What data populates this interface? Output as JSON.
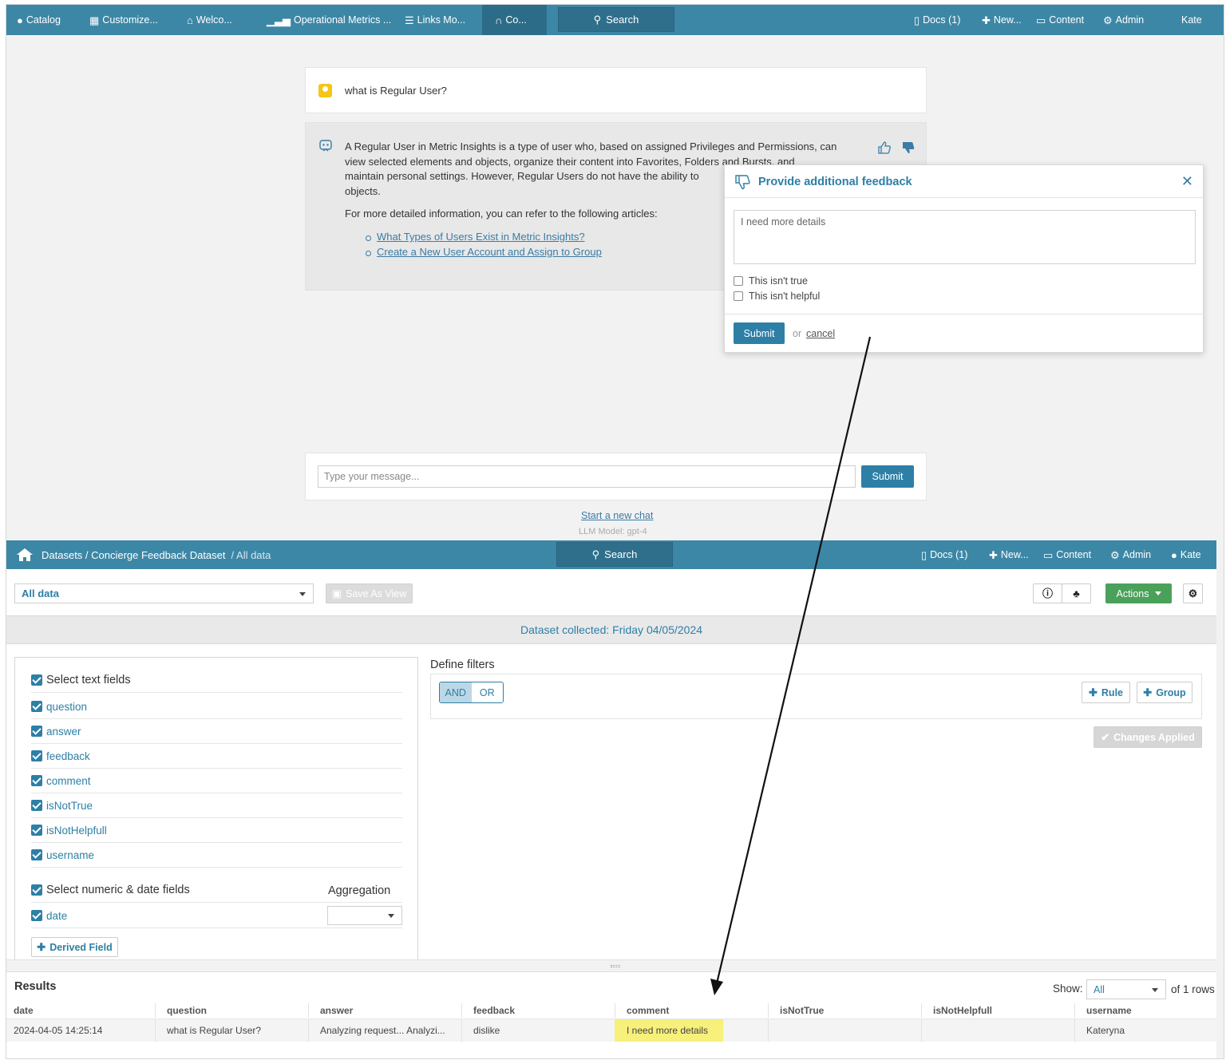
{
  "top_nav": {
    "items": [
      {
        "label": "Catalog",
        "icon": "circle-icon"
      },
      {
        "label": "Customize...",
        "icon": "grid-icon"
      },
      {
        "label": "Welco...",
        "icon": "home-icon"
      },
      {
        "label": "Operational Metrics ...",
        "icon": "bar-chart-icon"
      },
      {
        "label": "Links Mo...",
        "icon": "list-icon"
      },
      {
        "label": "Co...",
        "icon": "headset-icon"
      }
    ],
    "search_label": "Search",
    "docs_label": "Docs (1)",
    "new_label": "New...",
    "content_label": "Content",
    "admin_label": "Admin",
    "user_label": "Kate"
  },
  "chat": {
    "question": "what is Regular User?",
    "answer_lines": [
      "A Regular User in Metric Insights is a type of user who, based on assigned Privileges and Permissions, can",
      "view selected elements and objects, organize their content into Favorites, Folders and Bursts, and",
      "maintain personal settings. However, Regular Users do not have the ability to",
      "objects."
    ],
    "more_info": "For more detailed information, you can refer to the following articles:",
    "links": [
      "What Types of Users Exist in Metric Insights?",
      "Create a New User Account and Assign to Group"
    ],
    "message_placeholder": "Type your message...",
    "submit_label": "Submit",
    "new_chat_label": "Start a new chat",
    "model_label": "LLM Model: gpt-4"
  },
  "feedback_popup": {
    "title": "Provide additional feedback",
    "textarea_value": "I need more details",
    "options": [
      "This isn't true",
      "This isn't helpful"
    ],
    "submit_label": "Submit",
    "or_label": "or",
    "cancel_label": "cancel"
  },
  "dataset_bar": {
    "breadcrumb_main": "Datasets / Concierge Feedback Dataset",
    "breadcrumb_sub": "/ All data",
    "search_label": "Search",
    "docs_label": "Docs (1)",
    "new_label": "New...",
    "content_label": "Content",
    "admin_label": "Admin",
    "user_label": "Kate"
  },
  "toolbar": {
    "view_select": "All data",
    "save_as_view_label": "Save As View",
    "actions_label": "Actions"
  },
  "collected": "Dataset collected: Friday 04/05/2024",
  "fields": {
    "text_header": "Select text fields",
    "text_fields": [
      "question",
      "answer",
      "feedback",
      "comment",
      "isNotTrue",
      "isNotHelpfull",
      "username"
    ],
    "numeric_header": "Select numeric & date fields",
    "aggregation_label": "Aggregation",
    "numeric_fields": [
      "date"
    ],
    "derived_label": "Derived Field"
  },
  "filters": {
    "title": "Define filters",
    "and_label": "AND",
    "or_label": "OR",
    "rule_label": "Rule",
    "group_label": "Group",
    "changes_applied_label": "Changes Applied"
  },
  "results": {
    "title": "Results",
    "show_label": "Show:",
    "show_value": "All",
    "rows_label": "of 1 rows",
    "columns": [
      "date",
      "question",
      "answer",
      "feedback",
      "comment",
      "isNotTrue",
      "isNotHelpfull",
      "username"
    ],
    "rows": [
      [
        "2024-04-05 14:25:14",
        "what is Regular User?",
        "Analyzing request... Analyzi...",
        "dislike",
        "I need more details",
        "",
        "",
        "Kateryna"
      ]
    ]
  },
  "colors": {
    "nav": "#3d87a6",
    "accent": "#2d7fa6",
    "highlight": "#f7f07a",
    "green": "#4aa15a"
  }
}
